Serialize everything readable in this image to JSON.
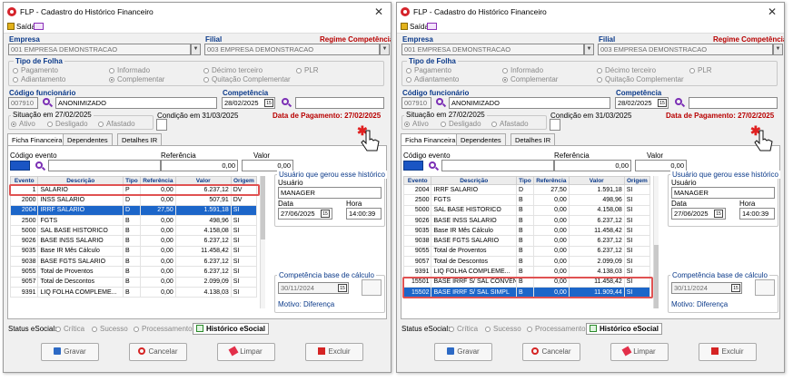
{
  "windows": [
    {
      "title": "FLP - Cadastro do Histórico Financeiro",
      "menu_exit": "Saída",
      "empresa_label": "Empresa",
      "empresa_value": "001 EMPRESA DEMONSTRACAO",
      "filial_label": "Filial",
      "filial_value": "003 EMPRESA DEMONSTRACAO",
      "regime_label": "Regime Competência",
      "tipo_folha_label": "Tipo de Folha",
      "tipo_folha_options": [
        "Pagamento",
        "Adiantamento",
        "Informado",
        "Complementar",
        "Décimo terceiro",
        "Quitação Complementar",
        "PLR"
      ],
      "tipo_folha_selected": "Complementar",
      "codigo_func_label": "Código funcionário",
      "codigo_func_value": "007910",
      "funcionario_name": "ANONIMIZADO",
      "competencia_label": "Competência",
      "competencia_value": "28/02/2025",
      "situacao_label": "Situação em 27/02/2025",
      "situacao_options": [
        "Ativo",
        "Desligado",
        "Afastado"
      ],
      "condicao_label": "Condição em 31/03/2025",
      "data_pagamento": "Data de Pagamento: 27/02/2025",
      "tabs": [
        "Ficha Financeira",
        "Dependentes",
        "Detalhes IR"
      ],
      "codigo_evento_label": "Código evento",
      "referencia_label": "Referência",
      "valor_label": "Valor",
      "referencia_value": "0,00",
      "valor_value": "0,00",
      "columns": [
        "Evento",
        "Descrição",
        "Tipo",
        "Referência",
        "Valor",
        "Origem"
      ],
      "rows": [
        [
          "1",
          "SALARIO",
          "P",
          "0,00",
          "6.237,12",
          "DV"
        ],
        [
          "2000",
          "INSS SALARIO",
          "D",
          "0,00",
          "507,91",
          "DV"
        ],
        [
          "2004",
          "IRRF SALARIO",
          "D",
          "27,50",
          "1.591,18",
          "SI"
        ],
        [
          "2500",
          "FGTS",
          "B",
          "0,00",
          "498,96",
          "SI"
        ],
        [
          "5000",
          "SAL BASE HISTORICO",
          "B",
          "0,00",
          "4.158,08",
          "SI"
        ],
        [
          "9026",
          "BASE INSS SALARIO",
          "B",
          "0,00",
          "6.237,12",
          "SI"
        ],
        [
          "9035",
          "Base IR Mês Cálculo",
          "B",
          "0,00",
          "11.458,42",
          "SI"
        ],
        [
          "9038",
          "BASE FGTS SALARIO",
          "B",
          "0,00",
          "6.237,12",
          "SI"
        ],
        [
          "9055",
          "Total de Proventos",
          "B",
          "0,00",
          "6.237,12",
          "SI"
        ],
        [
          "9057",
          "Total de Descontos",
          "B",
          "0,00",
          "2.099,09",
          "SI"
        ],
        [
          "9391",
          "LIQ FOLHA COMPLEME...",
          "B",
          "0,00",
          "4.138,03",
          "SI"
        ]
      ],
      "selected_row_index": 2,
      "usuario_group_label": "Usuário que gerou esse histórico",
      "usuario_label": "Usuário",
      "usuario_value": "MANAGER",
      "data_label": "Data",
      "data_value": "27/06/2025",
      "hora_label": "Hora",
      "hora_value": "14:00:39",
      "comp_base_label": "Competência base de cálculo",
      "comp_base_value": "30/11/2024",
      "motivo_text": "Motivo: Diferença",
      "status_label": "Status eSocial:",
      "status_options": [
        "Crítica",
        "Sucesso",
        "Processamento"
      ],
      "historico_btn": "Histórico eSocial",
      "buttons": [
        "Gravar",
        "Cancelar",
        "Limpar",
        "Excluir"
      ]
    },
    {
      "title": "FLP - Cadastro do Histórico Financeiro",
      "menu_exit": "Saída",
      "empresa_label": "Empresa",
      "empresa_value": "001 EMPRESA DEMONSTRACAO",
      "filial_label": "Filial",
      "filial_value": "003 EMPRESA DEMONSTRACAO",
      "regime_label": "Regime Competência",
      "tipo_folha_label": "Tipo de Folha",
      "tipo_folha_options": [
        "Pagamento",
        "Adiantamento",
        "Informado",
        "Complementar",
        "Décimo terceiro",
        "Quitação Complementar",
        "PLR"
      ],
      "tipo_folha_selected": "Complementar",
      "codigo_func_label": "Código funcionário",
      "codigo_func_value": "007910",
      "funcionario_name": "ANONIMIZADO",
      "competencia_label": "Competência",
      "competencia_value": "28/02/2025",
      "situacao_label": "Situação em 27/02/2025",
      "situacao_options": [
        "Ativo",
        "Desligado",
        "Afastado"
      ],
      "condicao_label": "Condição em 31/03/2025",
      "data_pagamento": "Data de Pagamento: 27/02/2025",
      "tabs": [
        "Ficha Financeira",
        "Dependentes",
        "Detalhes IR"
      ],
      "codigo_evento_label": "Código evento",
      "referencia_label": "Referência",
      "valor_label": "Valor",
      "referencia_value": "0,00",
      "valor_value": "0,00",
      "columns": [
        "Evento",
        "Descrição",
        "Tipo",
        "Referência",
        "Valor",
        "Origem"
      ],
      "rows": [
        [
          "2004",
          "IRRF SALARIO",
          "D",
          "27,50",
          "1.591,18",
          "SI"
        ],
        [
          "2500",
          "FGTS",
          "B",
          "0,00",
          "498,96",
          "SI"
        ],
        [
          "5000",
          "SAL BASE HISTORICO",
          "B",
          "0,00",
          "4.158,08",
          "SI"
        ],
        [
          "9026",
          "BASE INSS SALARIO",
          "B",
          "0,00",
          "6.237,12",
          "SI"
        ],
        [
          "9035",
          "Base IR Mês Cálculo",
          "B",
          "0,00",
          "11.458,42",
          "SI"
        ],
        [
          "9038",
          "BASE FGTS SALARIO",
          "B",
          "0,00",
          "6.237,12",
          "SI"
        ],
        [
          "9055",
          "Total de Proventos",
          "B",
          "0,00",
          "6.237,12",
          "SI"
        ],
        [
          "9057",
          "Total de Descontos",
          "B",
          "0,00",
          "2.099,09",
          "SI"
        ],
        [
          "9391",
          "LIQ FOLHA COMPLEME...",
          "B",
          "0,00",
          "4.138,03",
          "SI"
        ],
        [
          "15501",
          "BASE IRRF S/ SAL CONVEN",
          "B",
          "0,00",
          "11.458,42",
          "SI"
        ],
        [
          "15502",
          "BASE IRRF S/ SAL SIMPL",
          "B",
          "0,00",
          "11.909,44",
          "SI"
        ]
      ],
      "selected_row_index": 10,
      "usuario_group_label": "Usuário que gerou esse histórico",
      "usuario_label": "Usuário",
      "usuario_value": "MANAGER",
      "data_label": "Data",
      "data_value": "27/06/2025",
      "hora_label": "Hora",
      "hora_value": "14:00:39",
      "comp_base_label": "Competência base de cálculo",
      "comp_base_value": "30/11/2024",
      "motivo_text": "Motivo: Diferença",
      "status_label": "Status eSocial:",
      "status_options": [
        "Crítica",
        "Sucesso",
        "Processamento"
      ],
      "historico_btn": "Histórico eSocial",
      "buttons": [
        "Gravar",
        "Cancelar",
        "Limpar",
        "Excluir"
      ]
    }
  ],
  "colors": {
    "label_blue": "#0b3a8a",
    "label_red": "#b80000",
    "selection": "#1c66c9",
    "highlight": "#e05252"
  }
}
